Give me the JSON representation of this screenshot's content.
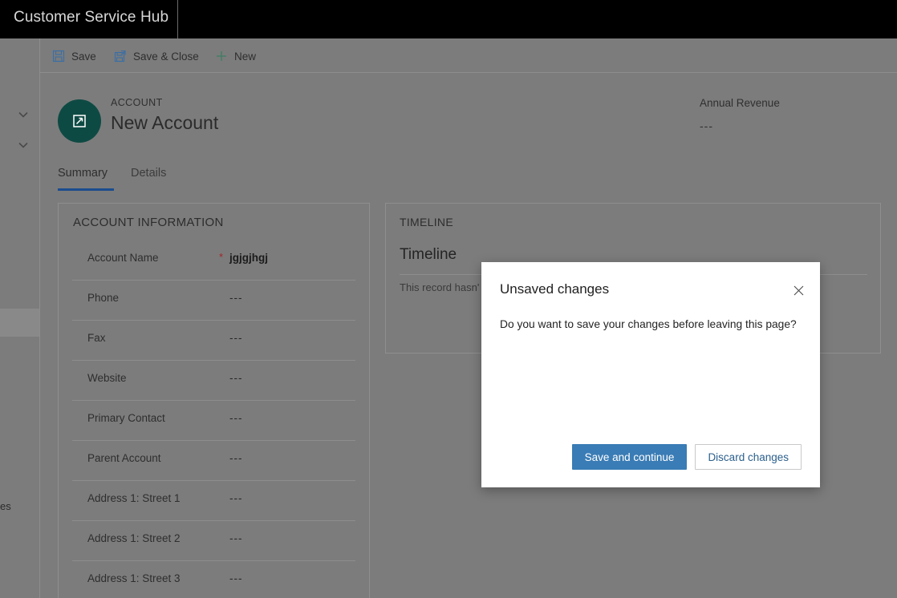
{
  "app": {
    "title": "Customer Service Hub"
  },
  "commandbar": {
    "buttons": [
      {
        "label": "Save",
        "icon": "save-icon"
      },
      {
        "label": "Save & Close",
        "icon": "save-and-close-icon"
      },
      {
        "label": "New",
        "icon": "plus-icon"
      }
    ]
  },
  "sidebar": {
    "clipped_text": "es",
    "chevron_icon": "chevron-down-icon"
  },
  "record": {
    "entity_label": "ACCOUNT",
    "title": "New Account",
    "avatar_icon": "account-icon",
    "stat_label": "Annual Revenue",
    "stat_value": "---"
  },
  "tabs": [
    {
      "label": "Summary",
      "selected": true
    },
    {
      "label": "Details",
      "selected": false
    }
  ],
  "account_panel": {
    "heading": "ACCOUNT INFORMATION",
    "fields": [
      {
        "label": "Account Name",
        "value": "jgjgjhgj",
        "required": true,
        "filled": true
      },
      {
        "label": "Phone",
        "value": "---",
        "required": false,
        "filled": false
      },
      {
        "label": "Fax",
        "value": "---",
        "required": false,
        "filled": false
      },
      {
        "label": "Website",
        "value": "---",
        "required": false,
        "filled": false
      },
      {
        "label": "Primary Contact",
        "value": "---",
        "required": false,
        "filled": false
      },
      {
        "label": "Parent Account",
        "value": "---",
        "required": false,
        "filled": false
      },
      {
        "label": "Address 1: Street 1",
        "value": "---",
        "required": false,
        "filled": false
      },
      {
        "label": "Address 1: Street 2",
        "value": "---",
        "required": false,
        "filled": false
      },
      {
        "label": "Address 1: Street 3",
        "value": "---",
        "required": false,
        "filled": false
      }
    ],
    "required_marker": "*"
  },
  "timeline_panel": {
    "heading": "TIMELINE",
    "title": "Timeline",
    "empty_text": "This record hasn'"
  },
  "dialog": {
    "title": "Unsaved changes",
    "message": "Do you want to save your changes before leaving this page?",
    "close_icon": "close-icon",
    "primary_button": "Save and continue",
    "secondary_button": "Discard changes"
  },
  "colors": {
    "app_bar": "#000000",
    "overlay": "#7c7c7c",
    "accent_blue": "#1a4d8f",
    "primary_button": "#3a7cb5",
    "avatar": "#0e4a44",
    "required_red": "#a4262c",
    "dialog_background": "#ffffff"
  }
}
